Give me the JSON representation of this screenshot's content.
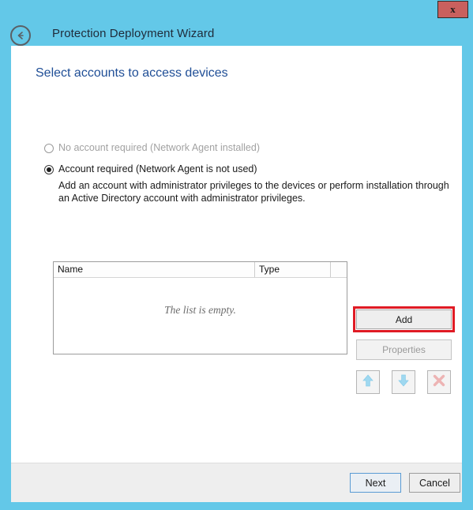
{
  "window": {
    "title": "Protection Deployment Wizard",
    "back_icon": "back-arrow-icon",
    "close_label": "x",
    "accent_cyan": "#63c8e8",
    "close_button_color": "#c9605e"
  },
  "page": {
    "heading": "Select accounts to access devices",
    "heading_color": "#1f4e96"
  },
  "options": [
    {
      "id": "no-account",
      "label": "No account required (Network Agent installed)",
      "selected": false,
      "disabled": true
    },
    {
      "id": "account-required",
      "label": "Account required (Network Agent is not used)",
      "selected": true,
      "disabled": false
    }
  ],
  "option_description": "Add an account with administrator privileges to the devices or perform installation through an Active Directory account with administrator privileges.",
  "accounts_list": {
    "columns": [
      "Name",
      "Type"
    ],
    "rows": [],
    "empty_text": "The list is empty."
  },
  "side_buttons": {
    "add_label": "Add",
    "properties_label": "Properties",
    "properties_disabled": true,
    "move_up_icon": "arrow-up-icon",
    "move_down_icon": "arrow-down-icon",
    "delete_icon": "delete-x-icon",
    "arrow_color": "#9fd8f0",
    "delete_color": "#edb4b4"
  },
  "highlight": {
    "color": "#e01b24",
    "target": "add-button"
  },
  "footer": {
    "next_label": "Next",
    "cancel_label": "Cancel"
  }
}
